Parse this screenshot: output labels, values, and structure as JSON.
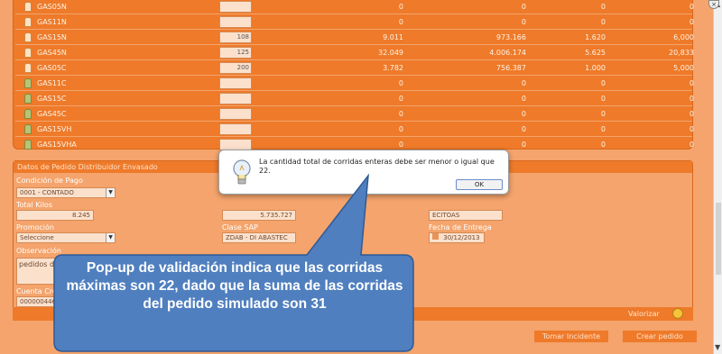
{
  "products": [
    {
      "name": "GAS05N",
      "icon": "orange",
      "qty": "",
      "v1": "0",
      "v2": "0",
      "v3": "0",
      "v4": "0"
    },
    {
      "name": "GAS11N",
      "icon": "orange",
      "qty": "",
      "v1": "0",
      "v2": "0",
      "v3": "0",
      "v4": "0"
    },
    {
      "name": "GAS15N",
      "icon": "orange",
      "qty": "108",
      "v1": "9.011",
      "v2": "973.166",
      "v3": "1.620",
      "v4": "6,000"
    },
    {
      "name": "GAS45N",
      "icon": "orange",
      "qty": "125",
      "v1": "32.049",
      "v2": "4.006.174",
      "v3": "5.625",
      "v4": "20,833"
    },
    {
      "name": "GAS05C",
      "icon": "orange",
      "qty": "200",
      "v1": "3.782",
      "v2": "756.387",
      "v3": "1.000",
      "v4": "5,000"
    },
    {
      "name": "GAS11C",
      "icon": "green",
      "qty": "",
      "v1": "0",
      "v2": "0",
      "v3": "0",
      "v4": "0"
    },
    {
      "name": "GAS15C",
      "icon": "green",
      "qty": "",
      "v1": "0",
      "v2": "0",
      "v3": "0",
      "v4": "0"
    },
    {
      "name": "GAS45C",
      "icon": "green",
      "qty": "",
      "v1": "0",
      "v2": "0",
      "v3": "0",
      "v4": "0"
    },
    {
      "name": "GAS15VH",
      "icon": "green",
      "qty": "",
      "v1": "0",
      "v2": "0",
      "v3": "0",
      "v4": "0"
    },
    {
      "name": "GAS15VHA",
      "icon": "green",
      "qty": "",
      "v1": "0",
      "v2": "0",
      "v3": "0",
      "v4": "0"
    }
  ],
  "order": {
    "header": "Datos de Pedido Distribuidor Envasado",
    "condicion_label": "Condición de Pago",
    "condicion_value": "0001 - CONTADO",
    "total_kilos_label": "Total Kilos",
    "total_kilos_value": "8.245",
    "mid_value": "5.735.727",
    "right_value": "ECITOAS",
    "promocion_label": "Promoción",
    "promocion_value": "Seleccione",
    "clase_sap_label": "Clase SAP",
    "clase_sap_value": "ZDAB - DI ABASTEC",
    "fecha_label": "Fecha de Entrega",
    "fecha_value": "30/12/2013",
    "observacion_label": "Observación",
    "observacion_value": "pedidos d",
    "cuenta_label": "Cuenta Cre",
    "cuenta_value": "000000446"
  },
  "bottom": {
    "valorizar": "Valorizar",
    "tomar_incidente": "Tomar Incidente",
    "crear_pedido": "Crear pedido"
  },
  "dialog": {
    "message": "La cantidad total de corridas enteras debe ser menor o igual que 22.",
    "ok": "OK"
  },
  "callout": {
    "text": "Pop-up de validación indica que las corridas máximas son 22, dado que la suma de las corridas del pedido simulado son 31"
  }
}
